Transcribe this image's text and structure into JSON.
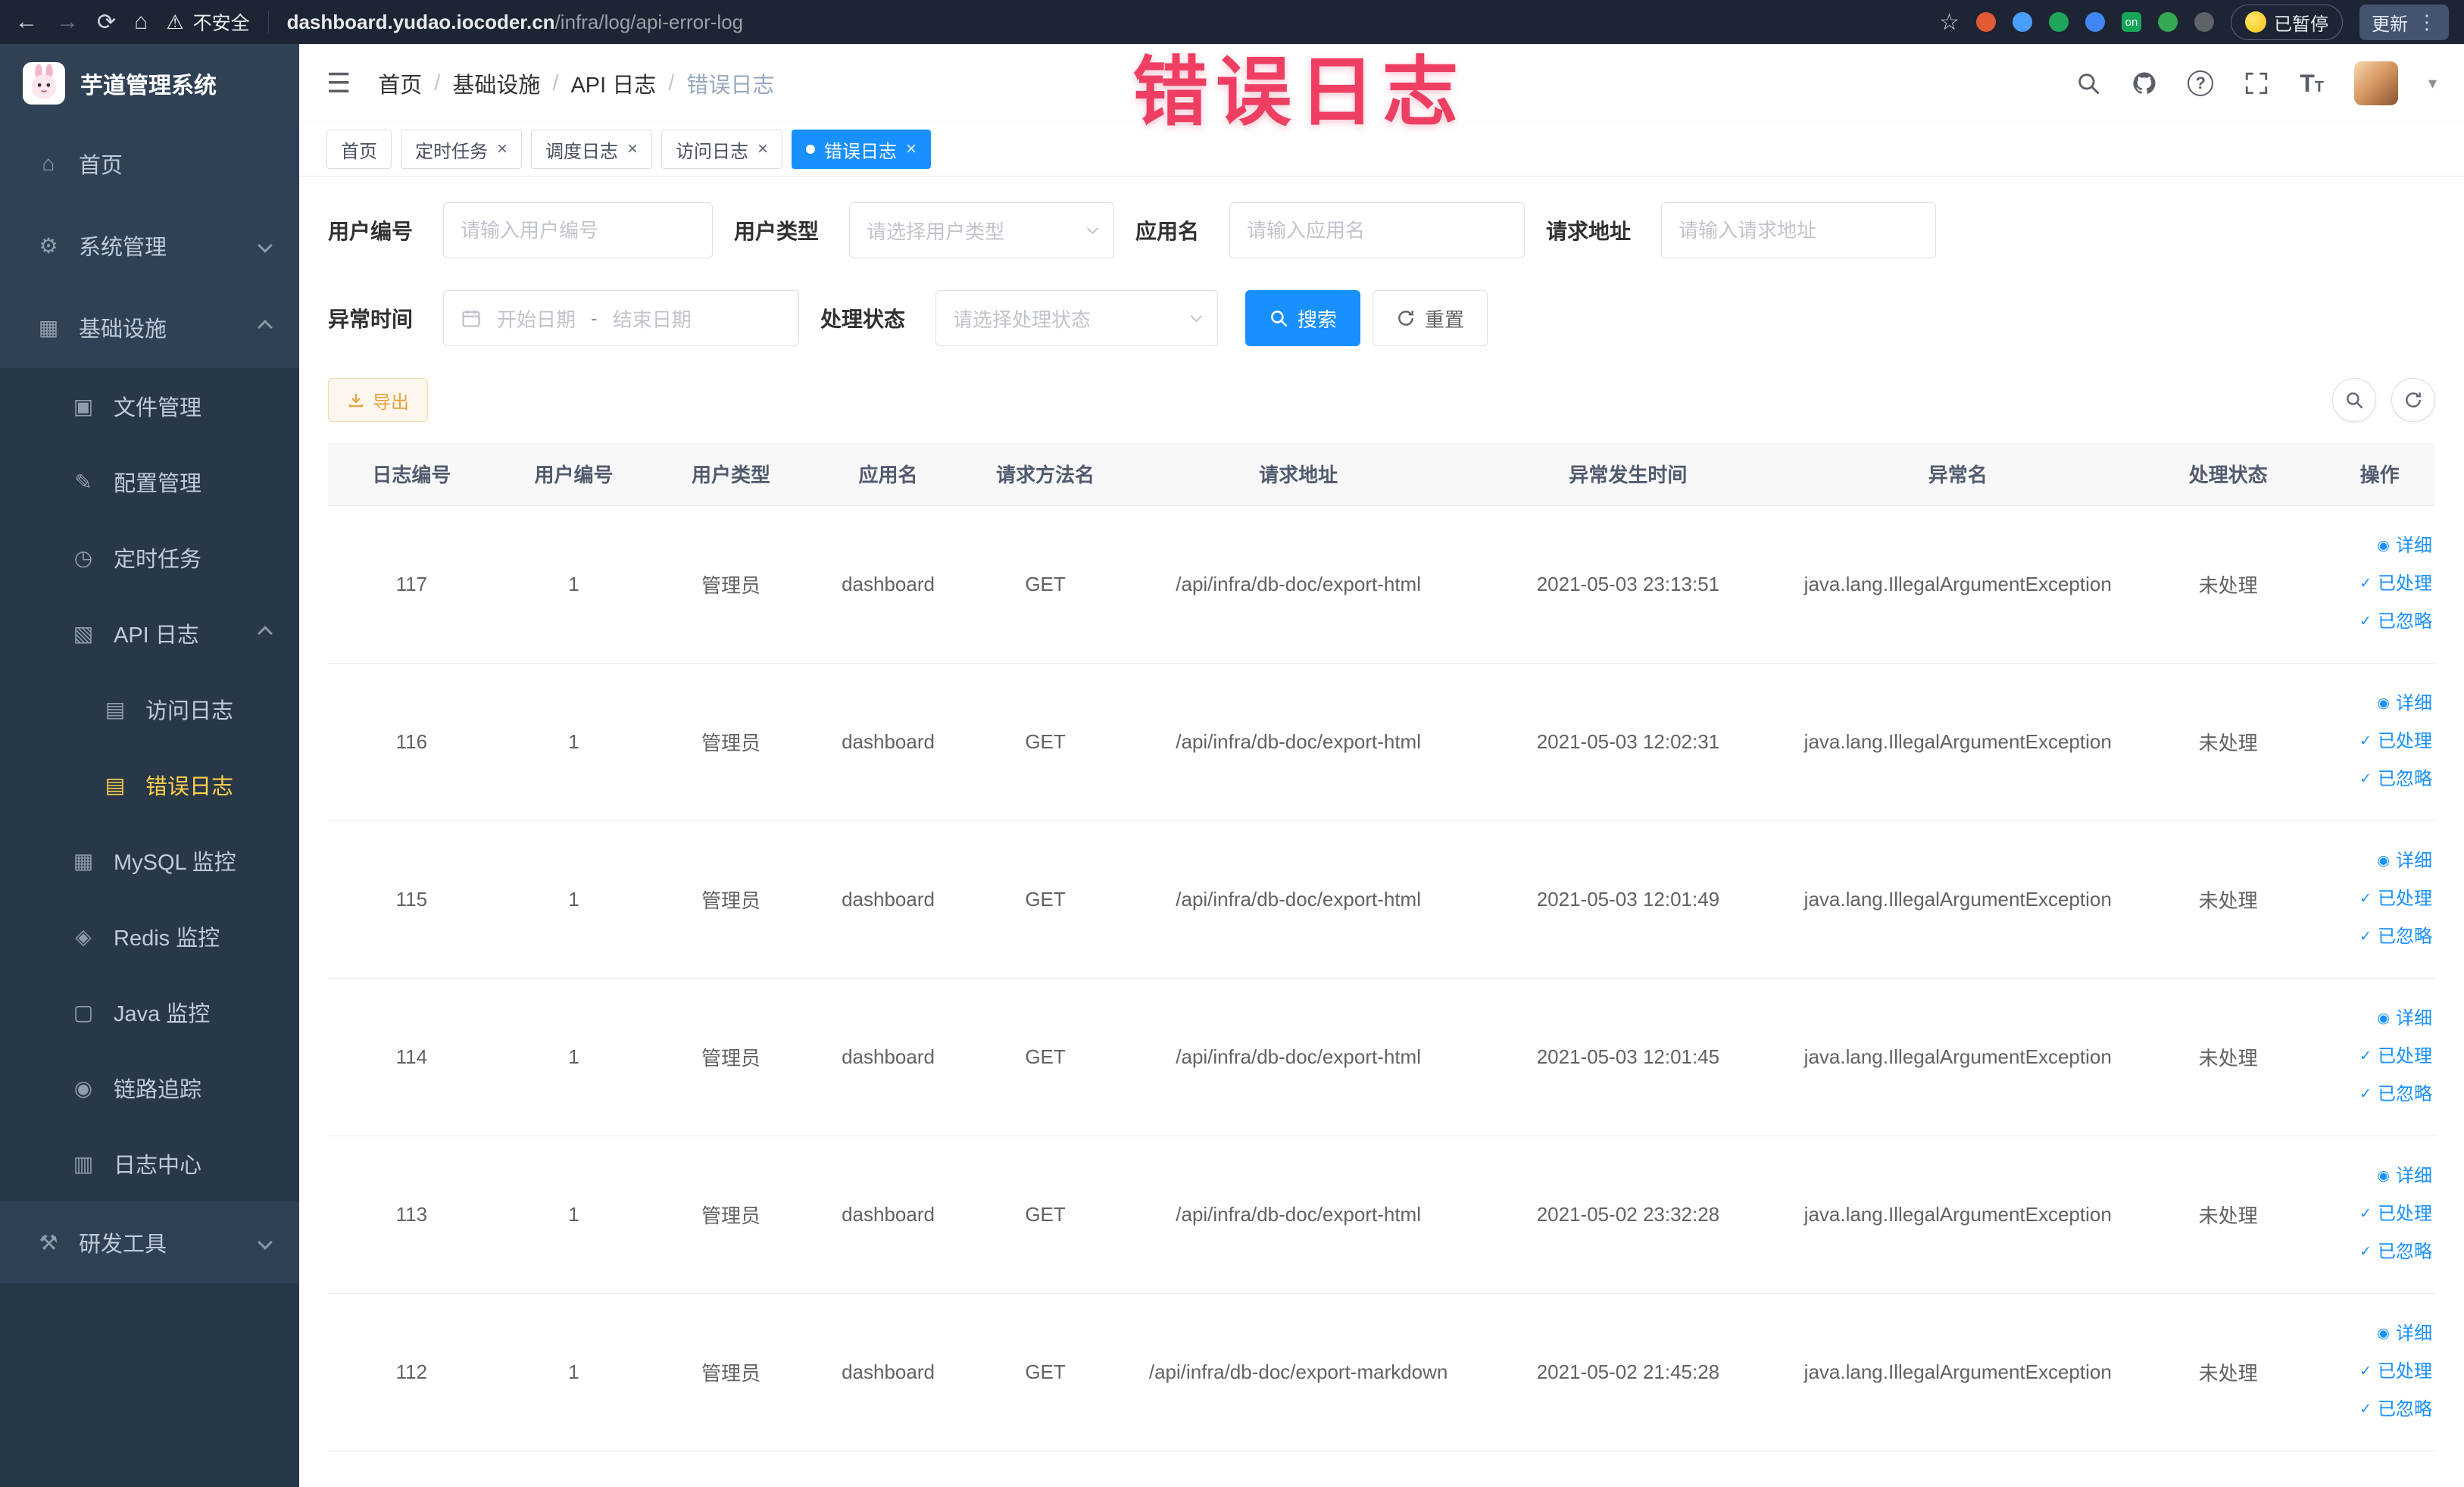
{
  "browser": {
    "security_label": "不安全",
    "url_host": "dashboard.yudao.iocoder.cn",
    "url_path": "/infra/log/api-error-log",
    "paused_label": "已暂停",
    "update_label": "更新",
    "on_badge": "on"
  },
  "annotation": {
    "text": "错误日志"
  },
  "sidebar": {
    "logo_title": "芋道管理系统",
    "items": [
      {
        "name": "home",
        "label": "首页",
        "icon": "home-icon",
        "level": 1
      },
      {
        "name": "system-management",
        "label": "系统管理",
        "icon": "gear-icon",
        "level": 1,
        "chevron": "down"
      },
      {
        "name": "infrastructure",
        "label": "基础设施",
        "icon": "infrastructure-icon",
        "level": 1,
        "chevron": "up"
      },
      {
        "name": "file-management",
        "label": "文件管理",
        "icon": "file-icon",
        "level": 2,
        "sub": true
      },
      {
        "name": "config-management",
        "label": "配置管理",
        "icon": "config-icon",
        "level": 2,
        "sub": true
      },
      {
        "name": "scheduled-tasks",
        "label": "定时任务",
        "icon": "timer-icon",
        "level": 2,
        "sub": true
      },
      {
        "name": "api-logs",
        "label": "API 日志",
        "icon": "api-log-icon",
        "level": 2,
        "sub": true,
        "chevron": "up"
      },
      {
        "name": "access-logs",
        "label": "访问日志",
        "icon": "access-log-icon",
        "level": 3,
        "sub": true
      },
      {
        "name": "error-logs",
        "label": "错误日志",
        "icon": "error-log-icon",
        "level": 3,
        "sub": true,
        "active": true
      },
      {
        "name": "mysql-monitor",
        "label": "MySQL 监控",
        "icon": "mysql-icon",
        "level": 2,
        "sub": true
      },
      {
        "name": "redis-monitor",
        "label": "Redis 监控",
        "icon": "redis-icon",
        "level": 2,
        "sub": true
      },
      {
        "name": "java-monitor",
        "label": "Java 监控",
        "icon": "java-icon",
        "level": 2,
        "sub": true
      },
      {
        "name": "link-trace",
        "label": "链路追踪",
        "icon": "trace-icon",
        "level": 2,
        "sub": true
      },
      {
        "name": "log-center",
        "label": "日志中心",
        "icon": "log-center-icon",
        "level": 2,
        "sub": true
      },
      {
        "name": "dev-tools",
        "label": "研发工具",
        "icon": "tools-icon",
        "level": 1,
        "chevron": "down"
      }
    ]
  },
  "breadcrumb": {
    "items": [
      "首页",
      "基础设施",
      "API 日志",
      "错误日志"
    ]
  },
  "tabs": [
    {
      "name": "home",
      "label": "首页",
      "closable": false
    },
    {
      "name": "scheduled-tasks",
      "label": "定时任务",
      "closable": true
    },
    {
      "name": "schedule-logs",
      "label": "调度日志",
      "closable": true
    },
    {
      "name": "access-logs",
      "label": "访问日志",
      "closable": true
    },
    {
      "name": "error-logs",
      "label": "错误日志",
      "closable": true,
      "active": true
    }
  ],
  "filters": {
    "user_id": {
      "label": "用户编号",
      "placeholder": "请输入用户编号"
    },
    "user_type": {
      "label": "用户类型",
      "placeholder": "请选择用户类型"
    },
    "app_name": {
      "label": "应用名",
      "placeholder": "请输入应用名"
    },
    "request_url": {
      "label": "请求地址",
      "placeholder": "请输入请求地址"
    },
    "exception_time": {
      "label": "异常时间",
      "start_placeholder": "开始日期",
      "separator": "-",
      "end_placeholder": "结束日期"
    },
    "process_status": {
      "label": "处理状态",
      "placeholder": "请选择处理状态"
    },
    "search_label": "搜索",
    "reset_label": "重置"
  },
  "toolbar": {
    "export_label": "导出"
  },
  "table": {
    "columns": [
      "日志编号",
      "用户编号",
      "用户类型",
      "应用名",
      "请求方法名",
      "请求地址",
      "异常发生时间",
      "异常名",
      "处理状态",
      "操作"
    ],
    "actions": [
      {
        "name": "detail-link",
        "label": "详细",
        "icon": "eye-icon"
      },
      {
        "name": "mark-processed-link",
        "label": "已处理",
        "icon": "check-icon"
      },
      {
        "name": "mark-ignored-link",
        "label": "已忽略",
        "icon": "check-icon"
      }
    ],
    "rows": [
      {
        "id": "117",
        "user_id": "1",
        "user_type": "管理员",
        "app": "dashboard",
        "method": "GET",
        "url": "/api/infra/db-doc/export-html",
        "time": "2021-05-03 23:13:51",
        "exception": "java.lang.IllegalArgumentException",
        "status": "未处理"
      },
      {
        "id": "116",
        "user_id": "1",
        "user_type": "管理员",
        "app": "dashboard",
        "method": "GET",
        "url": "/api/infra/db-doc/export-html",
        "time": "2021-05-03 12:02:31",
        "exception": "java.lang.IllegalArgumentException",
        "status": "未处理"
      },
      {
        "id": "115",
        "user_id": "1",
        "user_type": "管理员",
        "app": "dashboard",
        "method": "GET",
        "url": "/api/infra/db-doc/export-html",
        "time": "2021-05-03 12:01:49",
        "exception": "java.lang.IllegalArgumentException",
        "status": "未处理"
      },
      {
        "id": "114",
        "user_id": "1",
        "user_type": "管理员",
        "app": "dashboard",
        "method": "GET",
        "url": "/api/infra/db-doc/export-html",
        "time": "2021-05-03 12:01:45",
        "exception": "java.lang.IllegalArgumentException",
        "status": "未处理"
      },
      {
        "id": "113",
        "user_id": "1",
        "user_type": "管理员",
        "app": "dashboard",
        "method": "GET",
        "url": "/api/infra/db-doc/export-html",
        "time": "2021-05-02 23:32:28",
        "exception": "java.lang.IllegalArgumentException",
        "status": "未处理"
      },
      {
        "id": "112",
        "user_id": "1",
        "user_type": "管理员",
        "app": "dashboard",
        "method": "GET",
        "url": "/api/infra/db-doc/export-markdown",
        "time": "2021-05-02 21:45:28",
        "exception": "java.lang.IllegalArgumentException",
        "status": "未处理"
      }
    ]
  },
  "icons": {
    "back-icon": "←",
    "forward-icon": "→",
    "reload-icon": "⟳",
    "browser-home-icon": "⌂",
    "warning-icon": "⚠",
    "star-icon": "☆",
    "kebab-icon": "⋮",
    "hamburger-icon": "☰",
    "help-icon": "?",
    "close-icon": "×",
    "caret-down-icon": "▾",
    "home-icon": "⌂",
    "gear-icon": "⚙",
    "infrastructure-icon": "▦",
    "file-icon": "▣",
    "config-icon": "✎",
    "timer-icon": "◷",
    "api-log-icon": "▧",
    "access-log-icon": "▤",
    "error-log-icon": "▤",
    "mysql-icon": "▦",
    "redis-icon": "◈",
    "java-icon": "▢",
    "trace-icon": "◉",
    "log-center-icon": "▥",
    "tools-icon": "⚒",
    "eye-icon": "◉",
    "check-icon": "✓",
    "font-large-icon": "T",
    "font-small-icon": "T"
  }
}
